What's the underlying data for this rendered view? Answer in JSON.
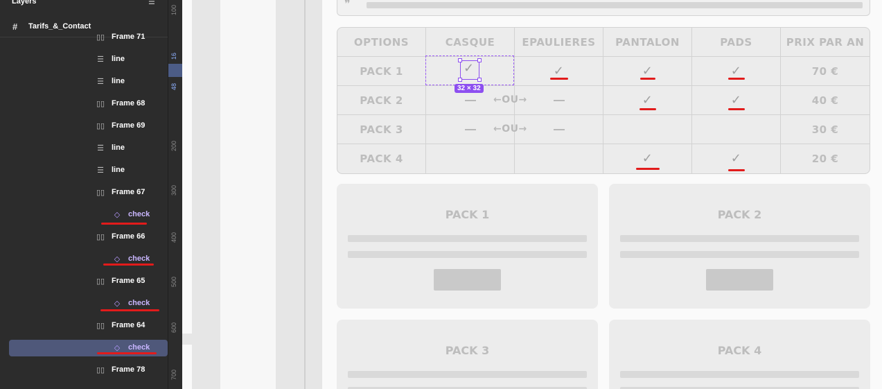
{
  "layers_panel": {
    "title": "Layers",
    "root_frame": "Tarifs_&_Contact",
    "items": [
      {
        "label": "Frame 71",
        "type": "frame"
      },
      {
        "label": "line",
        "type": "line"
      },
      {
        "label": "line",
        "type": "line"
      },
      {
        "label": "Frame 68",
        "type": "frame"
      },
      {
        "label": "Frame 69",
        "type": "frame"
      },
      {
        "label": "line",
        "type": "line"
      },
      {
        "label": "line",
        "type": "line"
      },
      {
        "label": "Frame 67",
        "type": "frame"
      },
      {
        "label": "check",
        "type": "component"
      },
      {
        "label": "Frame 66",
        "type": "frame"
      },
      {
        "label": "check",
        "type": "component"
      },
      {
        "label": "Frame 65",
        "type": "frame"
      },
      {
        "label": "check",
        "type": "component"
      },
      {
        "label": "Frame 64",
        "type": "frame"
      },
      {
        "label": "check",
        "type": "component",
        "selected": true
      },
      {
        "label": "Frame 78",
        "type": "frame"
      }
    ]
  },
  "ruler": {
    "ticks": [
      "100",
      "16",
      "48",
      "200",
      "300",
      "400",
      "500",
      "600",
      "700"
    ],
    "highlighted": [
      "16",
      "48"
    ]
  },
  "pricing_table": {
    "headers": [
      "OPTIONS",
      "CASQUE",
      "EPAULIERES",
      "PANTALON",
      "PADS",
      "PRIX PAR AN"
    ],
    "rows": [
      {
        "name": "PACK 1",
        "casque": "check",
        "epaulieres": "check",
        "pantalon": "check",
        "pads": "check",
        "price": "70 €"
      },
      {
        "name": "PACK 2",
        "casque": "dash",
        "epaulieres": "dash",
        "pantalon": "check",
        "pads": "check",
        "price": "40 €"
      },
      {
        "name": "PACK 3",
        "casque": "dash",
        "epaulieres": "dash",
        "pantalon": "",
        "pads": "",
        "price": "30 €"
      },
      {
        "name": "PACK 4",
        "casque": "",
        "epaulieres": "",
        "pantalon": "check",
        "pads": "check",
        "price": "20 €"
      }
    ],
    "or_label": "←OU→"
  },
  "selection": {
    "size_label": "32 × 32"
  },
  "cards": [
    {
      "title": "PACK 1"
    },
    {
      "title": "PACK 2"
    },
    {
      "title": "PACK 3"
    },
    {
      "title": "PACK 4"
    }
  ],
  "colors": {
    "accent": "#8d4ff0",
    "annotation_red": "#e21b1b",
    "panel_bg": "#2c2c2c"
  }
}
